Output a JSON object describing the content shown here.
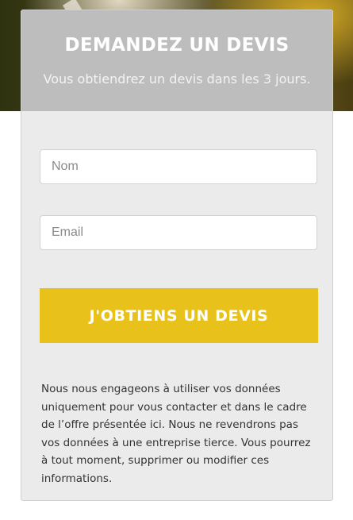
{
  "form": {
    "title": "DEMANDEZ UN DEVIS",
    "subtitle": "Vous obtiendrez un devis dans les 3 jours.",
    "name_placeholder": "Nom",
    "email_placeholder": "Email",
    "submit_label": "J'OBTIENS UN DEVIS",
    "disclaimer": "Nous nous engageons à utiliser vos données uniquement pour vous contacter et dans le cadre de l’offre présentée ici. Nous ne revendrons pas vos données à une entreprise tierce. Vous pourrez à tout moment, supprimer ou modifier ces informations."
  },
  "colors": {
    "accent": "#e8c21a",
    "card_background": "#ebebeb",
    "header_overlay": "#afafaf"
  }
}
